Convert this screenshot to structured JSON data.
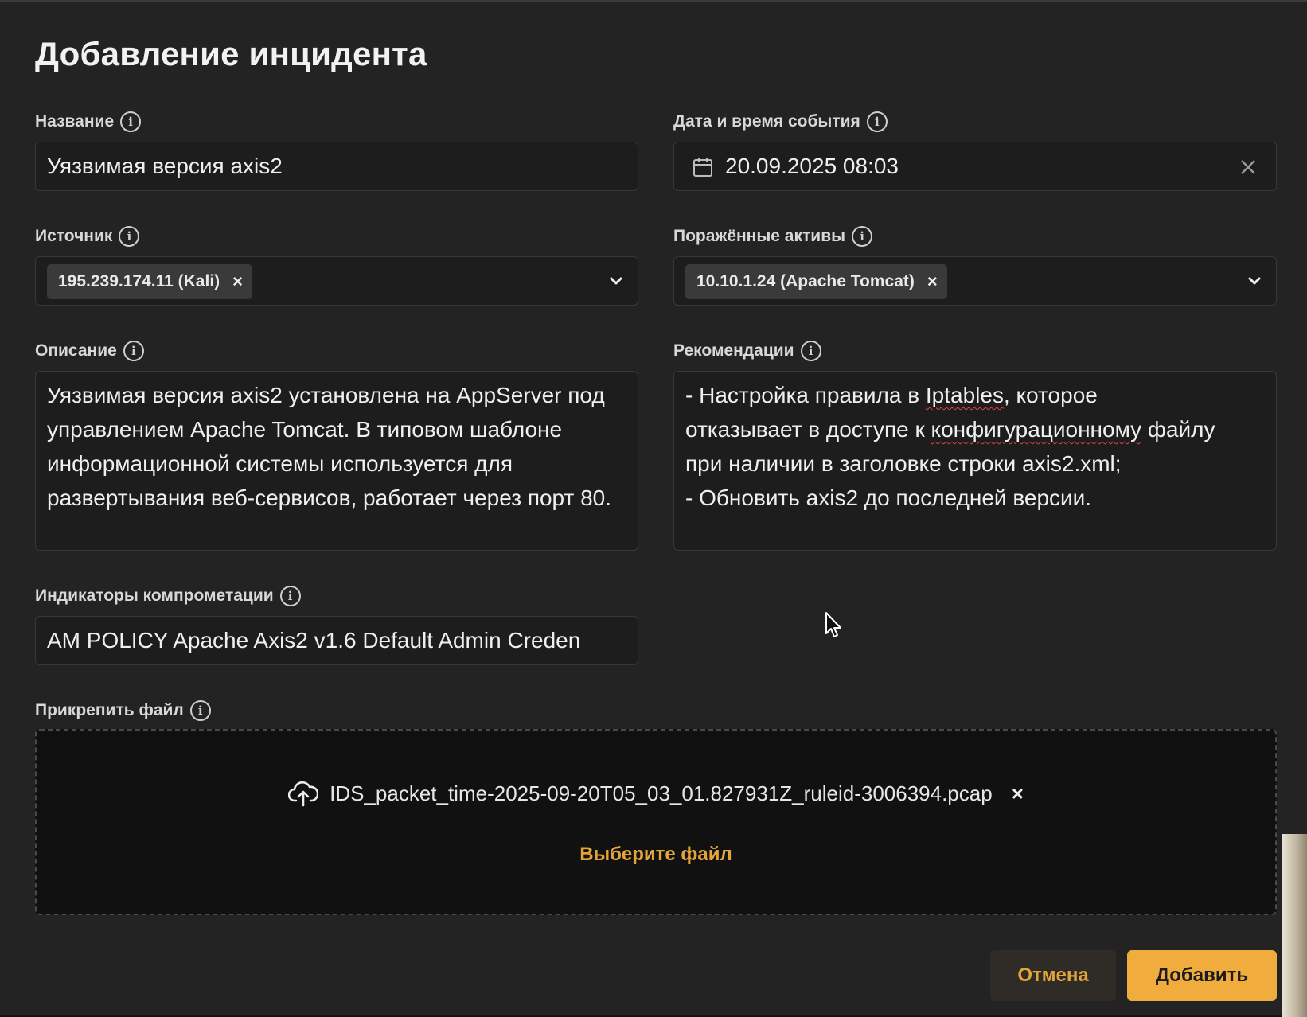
{
  "dialog": {
    "title": "Добавление инцидента",
    "accent_color": "#f0ac3c"
  },
  "fields": {
    "name": {
      "label": "Название",
      "value": "Уязвимая версия axis2"
    },
    "datetime": {
      "label": "Дата и время события",
      "value": "20.09.2025 08:03",
      "icon": "calendar-icon"
    },
    "source": {
      "label": "Источник",
      "chip": "195.239.174.11 (Kali)"
    },
    "assets": {
      "label": "Поражённые активы",
      "chip": "10.10.1.24 (Apache Tomcat)"
    },
    "description": {
      "label": "Описание",
      "value": "Уязвимая версия axis2 установлена на AppServer под управлением Apache Tomcat. В типовом шаблоне информационной системы используется для развертывания веб-сервисов, работает через порт 80."
    },
    "recommendations": {
      "label": "Рекомендации",
      "line1_a": "- Настройка правила в ",
      "line1_b": "Iptables",
      "line1_c": ", которое",
      "line2_a": "отказывает в доступе к ",
      "line2_b": "конфигурационному",
      "line2_c": " файлу",
      "line3": "при наличии в заголовке строки axis2.xml;",
      "line4": "- Обновить axis2 до последней версии."
    },
    "ioc": {
      "label": "Индикаторы компрометации",
      "value": "AM POLICY Apache Axis2 v1.6 Default Admin Creden"
    },
    "attach": {
      "label": "Прикрепить файл",
      "file_name": "IDS_packet_time-2025-09-20T05_03_01.827931Z_ruleid-3006394.pcap",
      "choose_label": "Выберите файл"
    }
  },
  "buttons": {
    "cancel": "Отмена",
    "add": "Добавить"
  }
}
